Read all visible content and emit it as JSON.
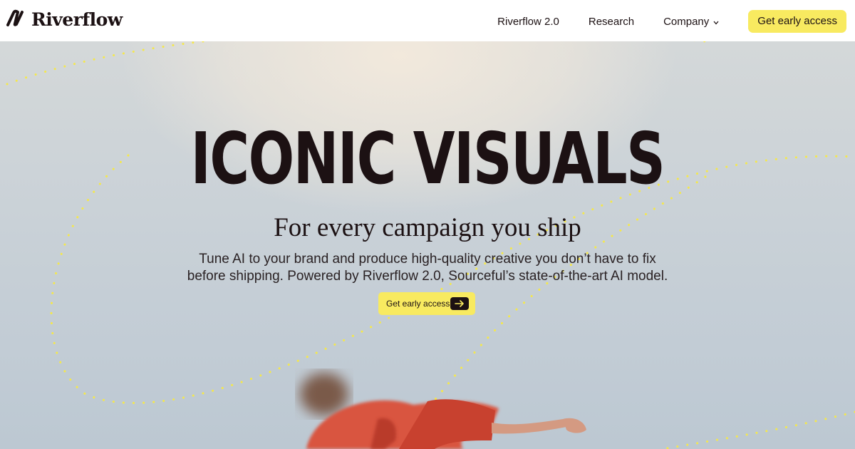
{
  "header": {
    "brand": "Riverflow",
    "nav": {
      "riverflow": "Riverflow 2.0",
      "research": "Research",
      "company": "Company",
      "cta": "Get early access"
    }
  },
  "hero": {
    "headline": "ICONIC VISUALS",
    "subheadline": "For every campaign you ship",
    "description_line1": "Tune AI to your brand and produce high-quality creative you don’t have to fix",
    "description_line2": "before shipping. Powered by Riverflow 2.0, Sourceful’s state-of-the-art AI model.",
    "cta": "Get early access"
  },
  "icons": {
    "logo": "logo-mark-icon",
    "dropdown": "chevron-down-icon",
    "cta_arrow": "arrow-right-icon"
  },
  "colors": {
    "accent_yellow": "#f8ea60",
    "text_dark": "#1c1113",
    "sky": "#c6cfd6"
  }
}
